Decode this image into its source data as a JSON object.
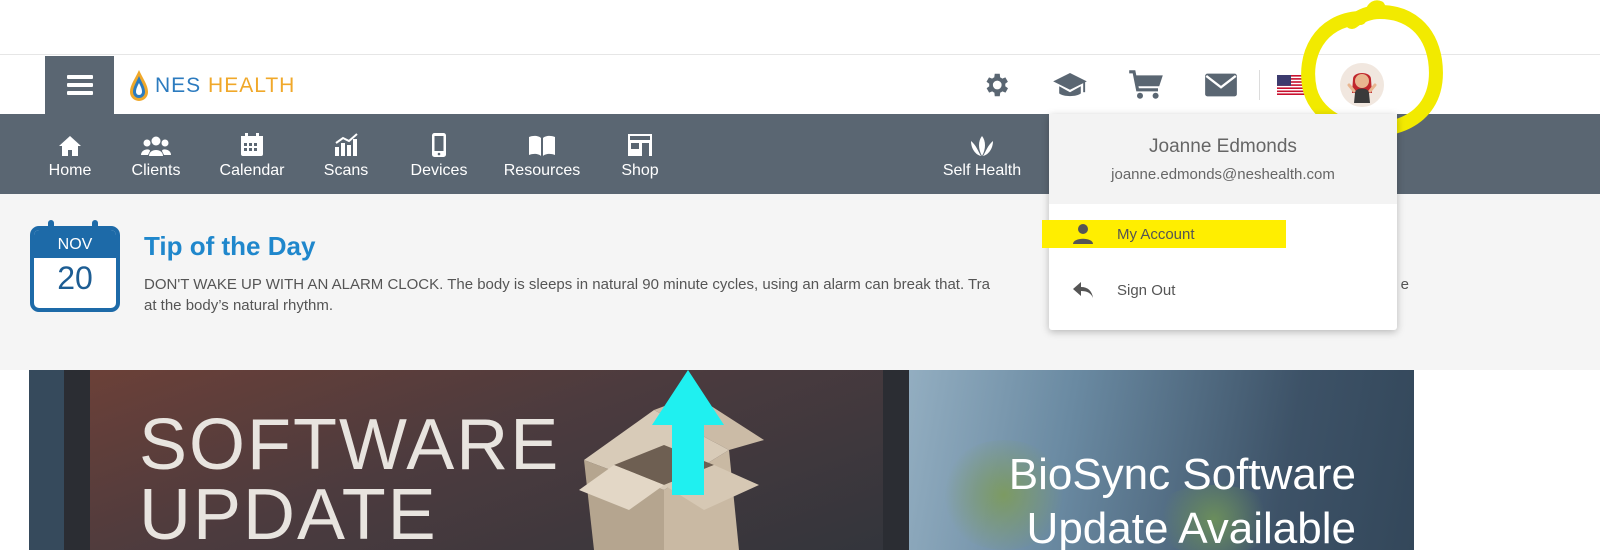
{
  "header": {
    "menu_icon": "hamburger-menu-icon",
    "logo": {
      "brand_first": "NES",
      "brand_second": "HEALTH"
    },
    "icons": [
      "gear-icon",
      "graduation-cap-icon",
      "shopping-cart-icon",
      "envelope-icon",
      "us-flag-icon",
      "avatar"
    ]
  },
  "nav": {
    "items": [
      {
        "label": "Home",
        "icon": "home-icon"
      },
      {
        "label": "Clients",
        "icon": "users-icon"
      },
      {
        "label": "Calendar",
        "icon": "calendar-icon"
      },
      {
        "label": "Scans",
        "icon": "chart-icon"
      },
      {
        "label": "Devices",
        "icon": "phone-icon"
      },
      {
        "label": "Resources",
        "icon": "book-icon"
      },
      {
        "label": "Shop",
        "icon": "store-icon"
      },
      {
        "label": "Self Health",
        "icon": "lotus-icon"
      }
    ]
  },
  "tip": {
    "month": "NOV",
    "day": "20",
    "title": "Tip of the Day",
    "text": "DON'T WAKE UP WITH AN ALARM CLOCK. The body is sleeps in natural 90 minute cycles, using an alarm can break that. Tra",
    "text_tail": "e",
    "text_line2": "at the body’s natural rhythm."
  },
  "banner": {
    "left_line1": "SOFTWARE",
    "left_line2": "UPDATE",
    "right_line1": "BioSync Software",
    "right_line2": "Update Available"
  },
  "dropdown": {
    "user_name": "Joanne Edmonds",
    "user_email": "joanne.edmonds@neshealth.com",
    "items": [
      {
        "label": "My Account",
        "icon": "person-icon",
        "highlighted": true
      },
      {
        "label": "Sign Out",
        "icon": "reply-icon"
      }
    ]
  },
  "colors": {
    "nav_bg": "#5a6672",
    "accent_blue": "#1f87cc",
    "highlight_yellow": "#ffee00",
    "logo_orange": "#f0a82a"
  }
}
